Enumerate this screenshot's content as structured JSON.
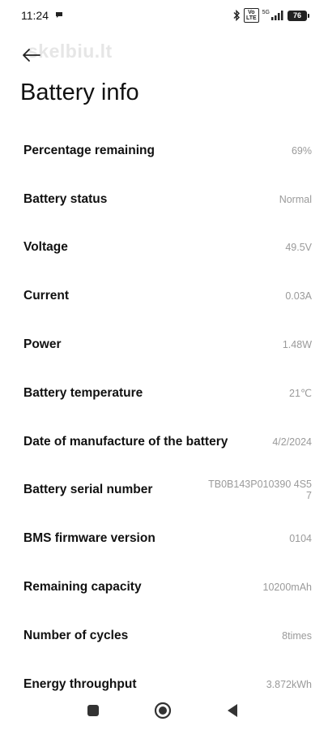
{
  "status_bar": {
    "time": "11:24",
    "volte": "Vo\nLTE",
    "network": "5G",
    "battery_level": "76",
    "icons": [
      "message-icon",
      "bluetooth-icon",
      "volte-icon",
      "signal-icon",
      "battery-icon"
    ]
  },
  "watermark": "skelbiu.lt",
  "header": {
    "title": "Battery info",
    "back_icon": "arrow-left-icon"
  },
  "rows": [
    {
      "label": "Percentage remaining",
      "value": "69%"
    },
    {
      "label": "Battery status",
      "value": "Normal"
    },
    {
      "label": "Voltage",
      "value": "49.5V"
    },
    {
      "label": "Current",
      "value": "0.03A"
    },
    {
      "label": "Power",
      "value": "1.48W"
    },
    {
      "label": "Battery temperature",
      "value": "21℃"
    },
    {
      "label": "Date of manufacture of the battery",
      "value": "4/2/2024"
    },
    {
      "label": "Battery serial number",
      "value": "TB0B143P010390 4S57"
    },
    {
      "label": "BMS firmware version",
      "value": "0104"
    },
    {
      "label": "Remaining capacity",
      "value": "10200mAh"
    },
    {
      "label": "Number of cycles",
      "value": "8times"
    },
    {
      "label": "Energy throughput",
      "value": "3.872kWh"
    }
  ],
  "nav_bar": {
    "icons": [
      "recents-icon",
      "home-icon",
      "back-icon"
    ]
  },
  "colors": {
    "background": "#ffffff",
    "label": "#111111",
    "value": "#9a9a9a"
  }
}
